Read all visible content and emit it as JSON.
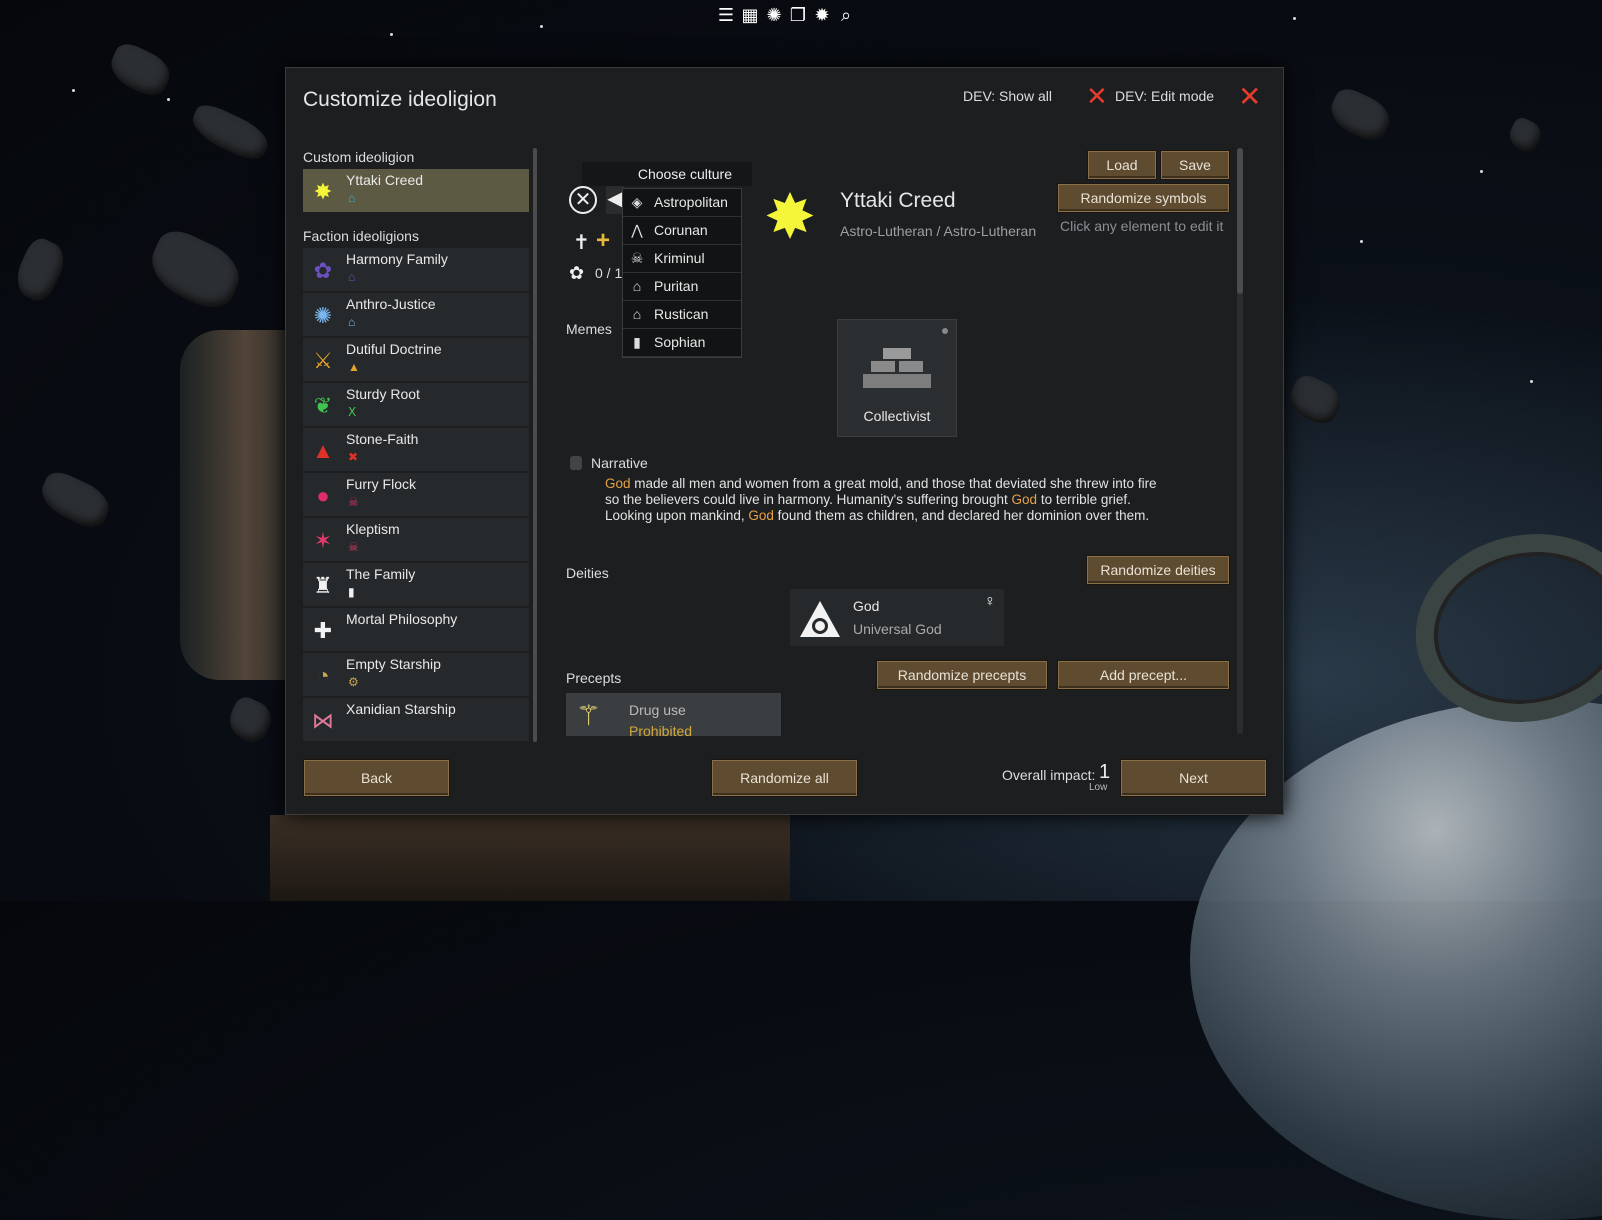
{
  "toolbar": {
    "icons": [
      "list-icon",
      "table-icon",
      "splat-icon",
      "stack-icon",
      "splat2-icon",
      "magnify-icon"
    ]
  },
  "dialog": {
    "title": "Customize ideoligion",
    "dev_show_all": "DEV: Show all",
    "dev_edit_mode": "DEV: Edit mode"
  },
  "left": {
    "custom_header": "Custom ideoligion",
    "custom": {
      "name": "Yttaki Creed",
      "color": "#f5f53a",
      "sub_color": "#2ab6d9"
    },
    "faction_header": "Faction ideoligions",
    "factions": [
      {
        "name": "Harmony Family",
        "icon": "flower-icon",
        "color": "#6a4fbf",
        "sub_color": "#6a4fbf"
      },
      {
        "name": "Anthro-Justice",
        "icon": "gear-icon",
        "color": "#79b7ef",
        "sub_color": "#79b7ef"
      },
      {
        "name": "Dutiful Doctrine",
        "icon": "cutlery-icon",
        "color": "#e6a22b",
        "sub_color": "#e6a22b"
      },
      {
        "name": "Sturdy Root",
        "icon": "wings-icon",
        "color": "#3fc44d",
        "sub_color": "#3fc44d"
      },
      {
        "name": "Stone-Faith",
        "icon": "triangle-icon",
        "color": "#e0302a",
        "sub_color": "#e0302a"
      },
      {
        "name": "Furry Flock",
        "icon": "droplet-icon",
        "color": "#e02d6a",
        "sub_color": "#e02d6a"
      },
      {
        "name": "Kleptism",
        "icon": "claw-icon",
        "color": "#e23a6b",
        "sub_color": "#e23a6b"
      },
      {
        "name": "The Family",
        "icon": "tower-icon",
        "color": "#f2f2f2",
        "sub_color": "#f2f2f2"
      },
      {
        "name": "Mortal Philosophy",
        "icon": "compass-icon",
        "color": "#f2f2f2",
        "sub_color": "#f2f2f2"
      },
      {
        "name": "Empty Starship",
        "icon": "swirl-icon",
        "color": "#c9a24e",
        "sub_color": "#c9a24e"
      },
      {
        "name": "Xanidian Starship",
        "icon": "bow-icon",
        "color": "#e07a9a",
        "sub_color": "#e07a9a"
      }
    ]
  },
  "buttons": {
    "load": "Load",
    "save": "Save",
    "randomize_symbols": "Randomize symbols",
    "randomize_deities": "Randomize deities",
    "randomize_precepts": "Randomize precepts",
    "add_precept": "Add precept...",
    "back": "Back",
    "randomize_all": "Randomize all",
    "next": "Next"
  },
  "culture": {
    "ratio": "0 / 1",
    "dropdown_title": "Choose culture",
    "options": [
      "Astropolitan",
      "Corunan",
      "Kriminul",
      "Puritan",
      "Rustican",
      "Sophian"
    ]
  },
  "ideo": {
    "name": "Yttaki Creed",
    "adjective": "Astro-Lutheran / Astro-Lutheran",
    "hint": "Click any element to edit it"
  },
  "memes": {
    "label": "Memes",
    "items": [
      {
        "name": "Collectivist"
      }
    ]
  },
  "narrative": {
    "label": "Narrative",
    "lines": [
      [
        "God",
        " made all men and women from a great mold, and those that deviated she threw into fire"
      ],
      [
        "so the believers could live in harmony. Humanity's suffering brought ",
        "God",
        " to terrible grief."
      ],
      [
        "Looking upon mankind, ",
        "God",
        " found them as children, and declared her dominion over them."
      ]
    ]
  },
  "deities": {
    "label": "Deities",
    "items": [
      {
        "name": "God",
        "title": "Universal God",
        "gender": "♀"
      }
    ]
  },
  "precepts": {
    "label": "Precepts",
    "items": [
      {
        "name": "Drug use",
        "value": "Prohibited"
      }
    ]
  },
  "impact": {
    "label": "Overall impact:",
    "value": "1",
    "level": "Low"
  }
}
